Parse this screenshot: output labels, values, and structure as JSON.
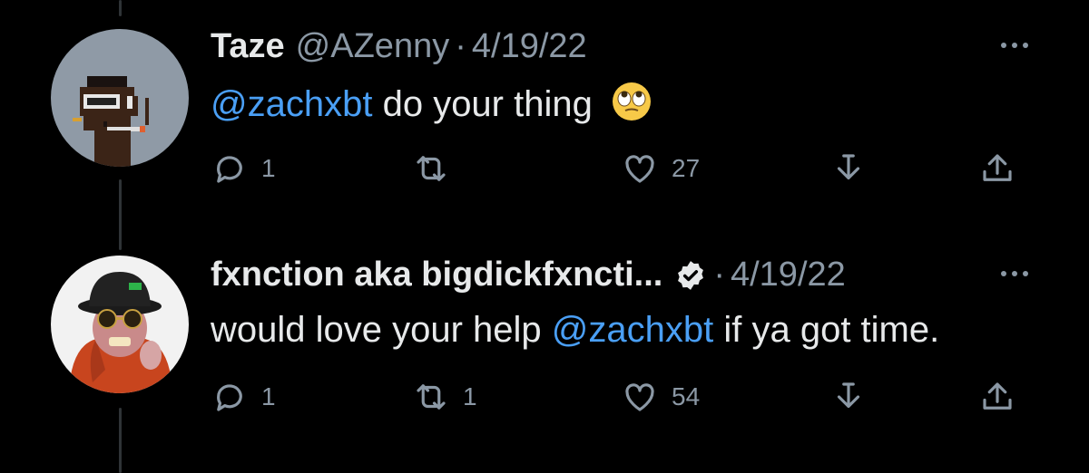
{
  "tweets": [
    {
      "name": "Taze",
      "handle": "@AZenny",
      "separator": "·",
      "date": "4/19/22",
      "mention": "@zachxbt",
      "text_after": " do your thing",
      "emoji": "face-with-rolling-eyes",
      "verified": false,
      "reply_count": "1",
      "retweet_count": "",
      "like_count": "27"
    },
    {
      "name": "fxnction aka bigdickfxncti...",
      "handle": "",
      "separator": "·",
      "date": "4/19/22",
      "text_before": "would love your help ",
      "mention": "@zachxbt",
      "text_after": " if ya got time.",
      "verified": true,
      "reply_count": "1",
      "retweet_count": "1",
      "like_count": "54"
    }
  ],
  "colors": {
    "background": "#000000",
    "text": "#e7e9ea",
    "secondary": "#8b98a5",
    "mention": "#4a9ff5",
    "thread_line": "#2f3336"
  },
  "icons": [
    "reply-icon",
    "retweet-icon",
    "like-icon",
    "download-icon",
    "share-icon",
    "more-icon",
    "verified-icon"
  ]
}
